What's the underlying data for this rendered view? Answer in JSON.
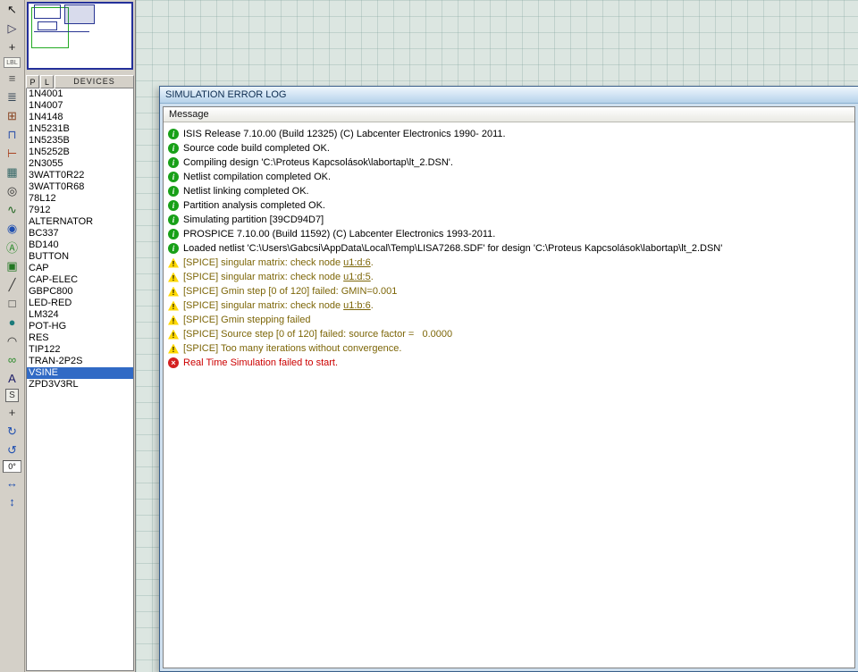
{
  "colors": {
    "selection_blue": "#316ac5",
    "warning_text": "#7d6608",
    "error_text": "#cc0000",
    "info_icon_green": "#18a018",
    "warning_icon_yellow": "#ffd800",
    "error_icon_red": "#d42020",
    "workspace_grid_bg": "#dce6e1"
  },
  "toolbar": {
    "icons": [
      {
        "name": "selection-pointer-icon",
        "glyph": "↖",
        "color": "#111111"
      },
      {
        "name": "component-mode-icon",
        "glyph": "▷",
        "color": "#333355"
      },
      {
        "name": "junction-dot-icon",
        "glyph": "+",
        "color": "#222222"
      },
      {
        "name": "wire-label-icon",
        "glyph": "LBL",
        "small": true,
        "color": "#555555"
      },
      {
        "name": "text-script-icon",
        "glyph": "≡",
        "color": "#555555"
      },
      {
        "name": "buses-icon",
        "glyph": "≣",
        "color": "#334455"
      },
      {
        "name": "subcircuit-icon",
        "glyph": "⊞",
        "color": "#884422"
      },
      {
        "name": "terminals-mode-icon",
        "glyph": "⊓",
        "color": "#3355aa"
      },
      {
        "name": "device-pins-icon",
        "glyph": "⊢",
        "color": "#aa4422"
      },
      {
        "name": "graph-mode-icon",
        "glyph": "▦",
        "color": "#336666"
      },
      {
        "name": "tape-recorder-icon",
        "glyph": "◎",
        "color": "#333333"
      },
      {
        "name": "generator-mode-icon",
        "glyph": "∿",
        "color": "#226622"
      },
      {
        "name": "voltage-probe-icon",
        "glyph": "◉",
        "color": "#1f4fb0"
      },
      {
        "name": "current-probe-icon",
        "glyph": "Ⓐ",
        "color": "#2a8a2a"
      },
      {
        "name": "virtual-instruments-icon",
        "glyph": "▣",
        "color": "#227722"
      },
      {
        "name": "2d-line-icon",
        "glyph": "╱",
        "color": "#333333"
      },
      {
        "name": "2d-box-icon",
        "glyph": "□",
        "color": "#333333"
      },
      {
        "name": "2d-circle-icon",
        "glyph": "●",
        "color": "#1b7a7a"
      },
      {
        "name": "2d-arc-icon",
        "glyph": "◠",
        "color": "#333333"
      },
      {
        "name": "2d-path-icon",
        "glyph": "∞",
        "color": "#2a8a2a"
      },
      {
        "name": "2d-text-icon",
        "glyph": "A",
        "color": "#1a1a66"
      },
      {
        "name": "2d-symbol-icon",
        "glyph": "S",
        "boxed": true,
        "color": "#333333"
      },
      {
        "name": "2d-marker-icon",
        "glyph": "+",
        "color": "#333333"
      },
      {
        "name": "rotate-clockwise-icon",
        "glyph": "↻",
        "color": "#1f4fb0"
      },
      {
        "name": "rotate-anticlockwise-icon",
        "glyph": "↺",
        "color": "#1f4fb0"
      },
      {
        "name": "rotation-angle-field",
        "glyph": "0°",
        "field": true,
        "color": "#000000"
      },
      {
        "name": "mirror-horizontal-icon",
        "glyph": "↔",
        "color": "#1f4fb0"
      },
      {
        "name": "mirror-vertical-icon",
        "glyph": "↕",
        "color": "#1f4fb0"
      }
    ]
  },
  "selector": {
    "p_button": "P",
    "l_button": "L",
    "header": "DEVICES",
    "selected": "VSINE",
    "devices": [
      "1N4001",
      "1N4007",
      "1N4148",
      "1N5231B",
      "1N5235B",
      "1N5252B",
      "2N3055",
      "3WATT0R22",
      "3WATT0R68",
      "78L12",
      "7912",
      "ALTERNATOR",
      "BC337",
      "BD140",
      "BUTTON",
      "CAP",
      "CAP-ELEC",
      "GBPC800",
      "LED-RED",
      "LM324",
      "POT-HG",
      "RES",
      "TIP122",
      "TRAN-2P2S",
      "VSINE",
      "ZPD3V3RL"
    ]
  },
  "dialog": {
    "title": "SIMULATION ERROR LOG",
    "column_header": "Message",
    "messages": [
      {
        "type": "info",
        "text": "ISIS Release 7.10.00 (Build 12325) (C) Labcenter Electronics 1990- 2011."
      },
      {
        "type": "info",
        "text": "Source code build completed OK."
      },
      {
        "type": "info",
        "text": "Compiling design 'C:\\Proteus Kapcsolások\\labortap\\lt_2.DSN'."
      },
      {
        "type": "info",
        "text": "Netlist compilation completed OK."
      },
      {
        "type": "info",
        "text": "Netlist linking completed OK."
      },
      {
        "type": "info",
        "text": "Partition analysis completed OK."
      },
      {
        "type": "info",
        "text": "Simulating partition [39CD94D7]"
      },
      {
        "type": "info",
        "text": "PROSPICE 7.10.00 (Build 11592) (C) Labcenter Electronics 1993-2011."
      },
      {
        "type": "info",
        "text": "Loaded netlist 'C:\\Users\\Gabcsi\\AppData\\Local\\Temp\\LISA7268.SDF' for design 'C:\\Proteus Kapcsolások\\labortap\\lt_2.DSN'"
      },
      {
        "type": "warning",
        "prefix": "[SPICE] singular matrix: check node ",
        "link": "u1:d:6",
        "suffix": "."
      },
      {
        "type": "warning",
        "prefix": "[SPICE] singular matrix: check node ",
        "link": "u1:d:5",
        "suffix": "."
      },
      {
        "type": "warning",
        "text": "[SPICE] Gmin step [0 of 120] failed: GMIN=0.001"
      },
      {
        "type": "warning",
        "prefix": "[SPICE] singular matrix: check node ",
        "link": "u1:b:6",
        "suffix": "."
      },
      {
        "type": "warning",
        "text": "[SPICE] Gmin stepping failed"
      },
      {
        "type": "warning",
        "text": "[SPICE] Source step [0 of 120] failed: source factor =   0.0000"
      },
      {
        "type": "warning",
        "text": "[SPICE] Too many iterations without convergence."
      },
      {
        "type": "error",
        "text": "Real Time Simulation failed to start."
      }
    ]
  }
}
